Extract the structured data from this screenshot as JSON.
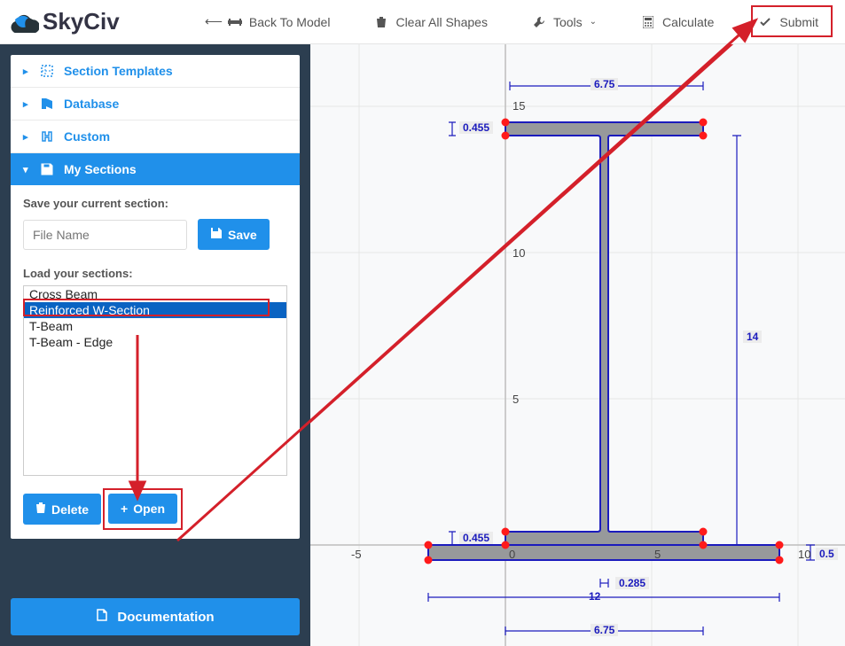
{
  "app": {
    "name": "SkyCiv"
  },
  "topmenu": {
    "back": "Back To Model",
    "clear": "Clear All Shapes",
    "tools": "Tools",
    "calculate": "Calculate",
    "submit": "Submit"
  },
  "sidebar": {
    "templates": "Section Templates",
    "database": "Database",
    "custom": "Custom",
    "mysections": "My Sections",
    "save_label": "Save your current section:",
    "filename_placeholder": "File Name",
    "save_btn": "Save",
    "load_label": "Load your sections:",
    "sections": [
      {
        "name": "Cross Beam",
        "selected": false
      },
      {
        "name": "Reinforced W-Section",
        "selected": true
      },
      {
        "name": "T-Beam",
        "selected": false
      },
      {
        "name": "T-Beam - Edge",
        "selected": false
      }
    ],
    "delete_btn": "Delete",
    "open_btn": "Open",
    "doc_btn": "Documentation"
  },
  "plot": {
    "x_ticks": [
      "-5",
      "0",
      "5",
      "10"
    ],
    "y_ticks": [
      "5",
      "10",
      "15"
    ],
    "dimensions": {
      "top_width": "6.75",
      "top_flange": "0.455",
      "bottom_flange": "0.455",
      "height": "14",
      "web": "0.285",
      "bottom_width_inner": "12",
      "bottom_width_span": "6.75",
      "bottom_plate_thk": "0.5"
    }
  }
}
